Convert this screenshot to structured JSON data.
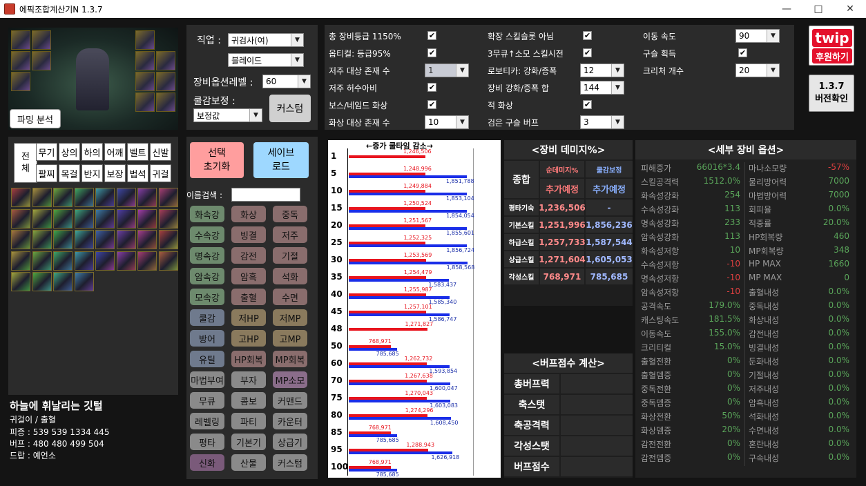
{
  "window": {
    "title": "에픽조합계산기N 1.3.7"
  },
  "character": {
    "parsing_button": "파밍 분석",
    "name": "하늘에 휘날리는 깃털",
    "sub": "귀걸이 / 출혈",
    "line1": "피증 : 539 539 1334 445",
    "line2": "버프 : 480 480 499 504",
    "line3": "드랍 : 예언소"
  },
  "settings": {
    "job_label": "직업 :",
    "job_value": "귀검사(여)",
    "subjob_value": "블레이드",
    "equip_level_label": "장비옵션레벨 :",
    "equip_level_value": "60",
    "cooldown_label": "쿨감보정 :",
    "cooldown_value": "보정값",
    "custom_button": "커스텀"
  },
  "options": {
    "col1": [
      {
        "label": "총 장비등급 1150%",
        "type": "check"
      },
      {
        "label": "옵티컬: 등급95%",
        "type": "check"
      },
      {
        "label": "저주 대상 존재 수",
        "type": "combo",
        "value": "1",
        "disabled": true
      },
      {
        "label": "저주 허수아비",
        "type": "check"
      },
      {
        "label": "보스/네임드 화상",
        "type": "check"
      },
      {
        "label": "화상 대상 존재 수",
        "type": "combo",
        "value": "10"
      }
    ],
    "col2": [
      {
        "label": "확장 스킬슬롯 아님",
        "type": "check"
      },
      {
        "label": "3무큐↑소모 스킬시전",
        "type": "check"
      },
      {
        "label": "로보티카: 강화/증폭",
        "type": "combo",
        "value": "12"
      },
      {
        "label": "장비 강화/증폭 합",
        "type": "combo",
        "value": "144"
      },
      {
        "label": "적 화상",
        "type": "check"
      },
      {
        "label": "검은 구슬 버프",
        "type": "combo",
        "value": "3"
      }
    ],
    "col3": [
      {
        "label": "이동 속도",
        "type": "combo",
        "value": "90"
      },
      {
        "label": "구슬 획득",
        "type": "check"
      },
      {
        "label": "크리처 개수",
        "type": "combo",
        "value": "20"
      }
    ],
    "check_mark": "✔"
  },
  "sponsor": {
    "logo": "twip",
    "label": "후원하기"
  },
  "version": {
    "number": "1.3.7",
    "label": "버전확인"
  },
  "categories": {
    "all_label": "전체",
    "row1": [
      "무기",
      "상의",
      "하의",
      "어깨",
      "벨트",
      "신발"
    ],
    "row2": [
      "팔찌",
      "목걸",
      "반지",
      "보장",
      "법석",
      "귀걸"
    ]
  },
  "actions": {
    "reset": "선택\n초기화",
    "save_load": "세이브\n로드",
    "search_label": "이름검색 :",
    "search_value": ""
  },
  "option_buttons": [
    {
      "label": "화속강",
      "color": "#6d8a6d"
    },
    {
      "label": "화상",
      "color": "#8a6d6d"
    },
    {
      "label": "중독",
      "color": "#8a6d6d"
    },
    {
      "label": "수속강",
      "color": "#6d8a6d"
    },
    {
      "label": "빙결",
      "color": "#8a6d6d"
    },
    {
      "label": "저주",
      "color": "#8a6d6d"
    },
    {
      "label": "명속강",
      "color": "#6d8a6d"
    },
    {
      "label": "감전",
      "color": "#8a6d6d"
    },
    {
      "label": "기절",
      "color": "#8a6d6d"
    },
    {
      "label": "암속강",
      "color": "#6d8a6d"
    },
    {
      "label": "암흑",
      "color": "#8a6d6d"
    },
    {
      "label": "석화",
      "color": "#8a6d6d"
    },
    {
      "label": "모속강",
      "color": "#6d8a6d"
    },
    {
      "label": "출혈",
      "color": "#8a6d6d"
    },
    {
      "label": "수면",
      "color": "#8a6d6d"
    },
    {
      "label": "쿨감",
      "color": "#6f7a8d"
    },
    {
      "label": "저HP",
      "color": "#8a7a5d"
    },
    {
      "label": "저MP",
      "color": "#8a7a5d"
    },
    {
      "label": "방어",
      "color": "#6f7a8d"
    },
    {
      "label": "고HP",
      "color": "#8a7a5d"
    },
    {
      "label": "고MP",
      "color": "#8a7a5d"
    },
    {
      "label": "유틸",
      "color": "#6f7a8d"
    },
    {
      "label": "HP회복",
      "color": "#8a6d6d"
    },
    {
      "label": "MP회복",
      "color": "#8a6d6d"
    },
    {
      "label": "마법부여",
      "color": "#8a8a8a"
    },
    {
      "label": "부자",
      "color": "#8a8a8a"
    },
    {
      "label": "MP소모",
      "color": "#8a6d8a"
    },
    {
      "label": "무큐",
      "color": "#8a8a8a"
    },
    {
      "label": "콤보",
      "color": "#8a8a8a"
    },
    {
      "label": "커맨드",
      "color": "#8a8a8a"
    },
    {
      "label": "레벨링",
      "color": "#8a8a8a"
    },
    {
      "label": "파티",
      "color": "#8a8a8a"
    },
    {
      "label": "카운터",
      "color": "#8a8a8a"
    },
    {
      "label": "평타",
      "color": "#8a8a8a"
    },
    {
      "label": "기본기",
      "color": "#8a8a8a"
    },
    {
      "label": "상급기",
      "color": "#8a8a8a"
    },
    {
      "label": "신화",
      "color": "#7a5a7a"
    },
    {
      "label": "산물",
      "color": "#8a8a8a"
    },
    {
      "label": "커스텀",
      "color": "#8a8a8a"
    }
  ],
  "chart_data": {
    "type": "bar",
    "title": "←증가 쿨타임 감소→",
    "categories": [
      "1",
      "5",
      "10",
      "15",
      "20",
      "25",
      "30",
      "35",
      "40",
      "45",
      "48",
      "50",
      "60",
      "70",
      "75",
      "80",
      "85",
      "95",
      "100"
    ],
    "series": [
      {
        "values": [
          1246506,
          1248996,
          1249884,
          1250524,
          1251567,
          1252325,
          1253569,
          1254479,
          1255987,
          1257101,
          1271827,
          768971,
          1262732,
          1267638,
          1270043,
          1274296,
          768971,
          1288943,
          768971
        ]
      },
      {
        "values": [
          null,
          1851788,
          1853104,
          1854054,
          1855601,
          1856724,
          1858568,
          1583437,
          1585340,
          1586747,
          null,
          785685,
          1593854,
          1600047,
          1603083,
          1608450,
          785685,
          1626918,
          785685
        ]
      }
    ],
    "red_labels": [
      "1,246,506",
      "1,248,996",
      "1,249,884",
      "1,250,524",
      "1,251,567",
      "1,252,325",
      "1,253,569",
      "1,254,479",
      "1,255,987",
      "1,257,101",
      "1,271,827",
      "768,971",
      "1,262,732",
      "1,267,638",
      "1,270,043",
      "1,274,296",
      "768,971",
      "1,288,943",
      "768,971"
    ],
    "blue_labels": [
      "",
      "1,851,788",
      "1,853,104",
      "1,854,054",
      "1,855,601",
      "1,856,724",
      "1,858,568",
      "1,583,437",
      "1,585,340",
      "1,586,747",
      "",
      "785,685",
      "1,593,854",
      "1,600,047",
      "1,603,083",
      "1,608,450",
      "785,685",
      "1,626,918",
      "785,685"
    ],
    "colors": {
      "red": "#e8141e",
      "blue": "#1a2ee8"
    }
  },
  "damage": {
    "title": "<장비 데미지%>",
    "h1": "순데미지%",
    "h2": "쿨감보정",
    "summary_label": "종합",
    "summary1": "추가예정",
    "summary2": "추가예정",
    "rows": [
      {
        "label": "평타기숙",
        "v1": "1,236,506",
        "v2": "-"
      },
      {
        "label": "기본스킬",
        "v1": "1,251,996",
        "v2": "1,856,236"
      },
      {
        "label": "하급스킬",
        "v1": "1,257,733",
        "v2": "1,587,544"
      },
      {
        "label": "상급스킬",
        "v1": "1,271,604",
        "v2": "1,605,053"
      },
      {
        "label": "각성스킬",
        "v1": "768,971",
        "v2": "785,685"
      }
    ]
  },
  "buff": {
    "title": "<버프점수 계산>",
    "rows": [
      "총버프력",
      "축스탯",
      "축공격력",
      "각성스탯",
      "버프점수"
    ]
  },
  "details": {
    "title": "<세부 장비 옵션>",
    "rows": [
      [
        "피해증가",
        "66016*3.4",
        "마나소모량",
        "-57%"
      ],
      [
        "스킬공격력",
        "1512.0%",
        "물리방어력",
        "7000"
      ],
      [
        "화속성강화",
        "254",
        "마법방어력",
        "7000"
      ],
      [
        "수속성강화",
        "113",
        "회피율",
        "0.0%"
      ],
      [
        "명속성강화",
        "233",
        "적중률",
        "20.0%"
      ],
      [
        "암속성강화",
        "113",
        "HP회복량",
        "460"
      ],
      [
        "화속성저항",
        "10",
        "MP회복량",
        "348"
      ],
      [
        "수속성저항",
        "-10",
        "HP MAX",
        "1660"
      ],
      [
        "명속성저항",
        "-10",
        "MP MAX",
        "0"
      ],
      [
        "암속성저항",
        "-10",
        "출혈내성",
        "0.0%"
      ],
      [
        "공격속도",
        "179.0%",
        "중독내성",
        "0.0%"
      ],
      [
        "캐스팅속도",
        "181.5%",
        "화상내성",
        "0.0%"
      ],
      [
        "이동속도",
        "155.0%",
        "감전내성",
        "0.0%"
      ],
      [
        "크리티컬",
        "15.0%",
        "빙결내성",
        "0.0%"
      ],
      [
        "출혈전환",
        "0%",
        "둔화내성",
        "0.0%"
      ],
      [
        "출혈뎀증",
        "0%",
        "기절내성",
        "0.0%"
      ],
      [
        "중독전환",
        "0%",
        "저주내성",
        "0.0%"
      ],
      [
        "중독뎀증",
        "0%",
        "암흑내성",
        "0.0%"
      ],
      [
        "화상전환",
        "50%",
        "석화내성",
        "0.0%"
      ],
      [
        "화상뎀증",
        "20%",
        "수면내성",
        "0.0%"
      ],
      [
        "감전전환",
        "0%",
        "혼란내성",
        "0.0%"
      ],
      [
        "감전뎀증",
        "0%",
        "구속내성",
        "0.0%"
      ]
    ]
  }
}
